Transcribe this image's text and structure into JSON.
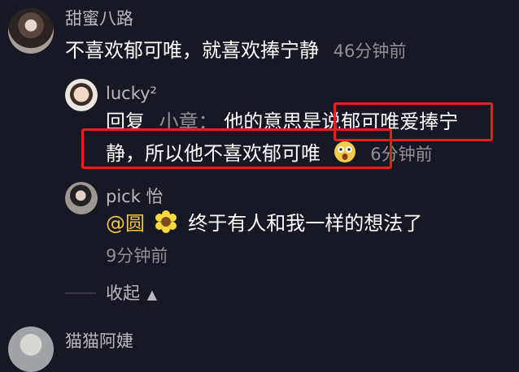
{
  "comments": [
    {
      "username": "甜蜜八路",
      "text": "不喜欢郁可唯，就喜欢捧宁静",
      "time": "46分钟前"
    }
  ],
  "replies": [
    {
      "username": "lucky²",
      "reply_prefix": "回复",
      "reply_target": "小章：",
      "text_line1": "他的意思是说郁可唯爱捧宁",
      "text_line2": "静，所以他不喜欢郁可唯",
      "emoji": "astonished-face-icon",
      "time": "6分钟前"
    },
    {
      "username": "pick 怡",
      "mention": "@圆",
      "emoji": "sunflower-icon",
      "text": "终于有人和我一样的想法了",
      "time": "9分钟前"
    }
  ],
  "collapse_label": "收起",
  "next_comment": {
    "username": "猫猫阿婕"
  },
  "colors": {
    "background": "#161823",
    "highlight": "#ee1d1d",
    "mention": "#f4c33c"
  }
}
